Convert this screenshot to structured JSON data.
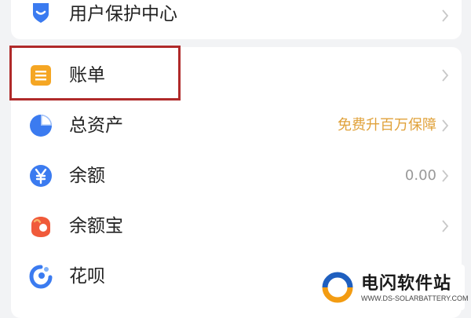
{
  "rows": [
    {
      "label": "用户保护中心",
      "value": "",
      "icon": "shield-icon"
    },
    {
      "label": "账单",
      "value": "",
      "icon": "bill-icon"
    },
    {
      "label": "总资产",
      "value": "免费升百万保障",
      "icon": "pie-chart-icon"
    },
    {
      "label": "余额",
      "value": "0.00",
      "icon": "yuan-icon"
    },
    {
      "label": "余额宝",
      "value": "",
      "icon": "yuebao-icon"
    },
    {
      "label": "花呗",
      "value": "",
      "icon": "huabei-icon"
    }
  ],
  "watermark": {
    "title": "电闪软件站",
    "url": "WWW.DS-SOLARBATTERY.COM"
  },
  "colors": {
    "accent_blue": "#3b7bf0",
    "bill_orange": "#f5a623",
    "promo_text": "#e0a23b",
    "highlight_red": "#b02a2a",
    "yuebao_red": "#f05a3a"
  }
}
